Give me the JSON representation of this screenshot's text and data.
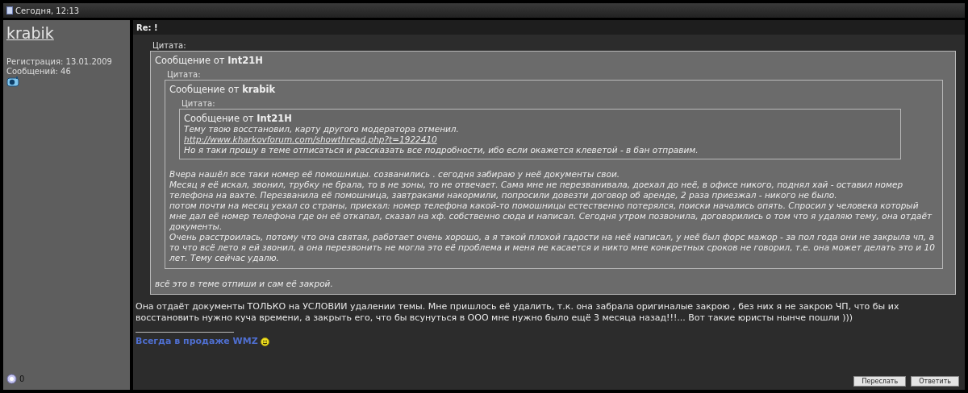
{
  "post_header": {
    "date": "Сегодня, 12:13"
  },
  "user": {
    "name": "krabik",
    "registration": "Регистрация: 13.01.2009",
    "posts": "Сообщений: 46",
    "reputation": "0"
  },
  "post": {
    "title": "Re: !",
    "quote": {
      "label": "Цитата:",
      "author": "Сообщение от **Int21H**",
      "quote": {
        "label": "Цитата:",
        "author": "Сообщение от **krabik**",
        "quote": {
          "label": "Цитата:",
          "author": "Сообщение от **Int21H**",
          "paragraphs": [
            {
              "kind": "text",
              "text": "Тему твою восстановил, карту другого модератора отменил."
            },
            {
              "kind": "link",
              "text": "http://www.kharkovforum.com/showthread.php?t=1922410"
            },
            {
              "kind": "text",
              "text": "Но я таки прошу в теме отписаться и рассказать все подробности, ибо если окажется клеветой - в бан отправим."
            }
          ]
        },
        "paragraphs": [
          {
            "kind": "text",
            "text": "Вчера нашёл все таки номер её помошницы. созванились . сегодня забираю у неё документы свои."
          },
          {
            "kind": "text",
            "text": "Месяц я её искал, звонил, трубку не брала, то в не зоны, то не отвечает. Сама мне не перезванивала, доехал до неё, в офисе никого, поднял хай - оставил номер телефона на вахте. Перезванила её помошница, завтраками накормили, попросили довезти договор об аренде, 2 раза приезжал - никого не было."
          },
          {
            "kind": "text",
            "text": "потом почти на месяц уехал со страны, приехал: номер телефона какой-то помошницы естественно потерялся, поиски начались опять. Спросил у человека который мне дал её номер телефона где он её откапал, сказал на хф. собственно сюда и написал. Сегодня утром позвонила, договорились о том что я удаляю тему, она отдаёт документы."
          },
          {
            "kind": "text",
            "text": "Очень расстроилась, потому что она святая, работает очень хорошо, а я такой плохой гадости на неё написал, у неё был форс мажор - за пол года они не закрыла чп, а то что всё лето я ей звонил, а она перезвонить не могла это её проблема и меня не касается и никто мне конкретных сроков не говорил, т.е. она может делать это и 10 лет. Тему сейчас удалю."
          }
        ]
      },
      "paragraphs": [
        {
          "kind": "text",
          "text": "всё это в теме отпиши и сам её закрой."
        }
      ]
    },
    "body": "Она отдаёт документы ТОЛЬКО на УСЛОВИИ удалении темы. Мне пришлось её удалить, т.к. она забрала оригиналые закрою , без них я не закрою ЧП, что бы их восстановить нужно куча времени, а закрыть его, что бы всунуться в ООО мне нужно было ещё 3 месяца назад!!!... Вот такие юристы нынче пошли )))",
    "signature": "Всегда в продаже WMZ"
  },
  "buttons": [
    "Переслать",
    "Ответить"
  ]
}
